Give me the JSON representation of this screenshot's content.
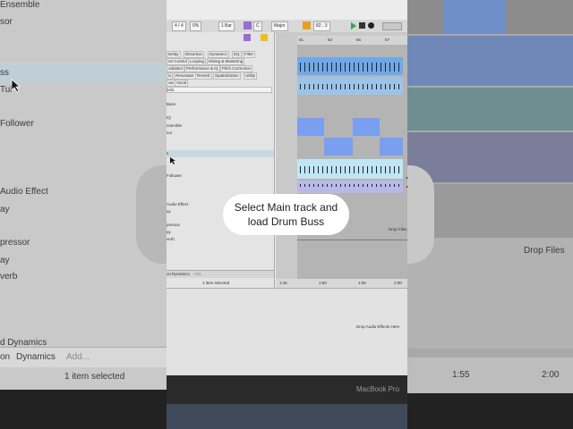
{
  "left_panel": {
    "items": [
      "Ensemble",
      "sor",
      "ss",
      "Tul",
      "Follower",
      "Audio Effect",
      "ay",
      "pressor",
      "ay",
      "verb",
      "d Dynamics"
    ],
    "tabs": [
      "on",
      "Dynamics",
      "Add..."
    ],
    "status": "1 item selected"
  },
  "right_panel": {
    "drop_text": "Drop Files",
    "time_labels": [
      "1:55",
      "2:00"
    ]
  },
  "toolbar": {
    "sig": "4 / 4",
    "zoom": "0%",
    "quant": "1 Bar",
    "key_root": "C",
    "key_mode": "Major",
    "position": "82 . 3"
  },
  "browser": {
    "tags_row1": [
      "Delay",
      "Distortion",
      "Dynamics",
      "EQ",
      "Filter"
    ],
    "tags_row2": [
      "ne Control",
      "Looping",
      "Mixing & Mastering"
    ],
    "tags_row3": [
      "odulator",
      "Performance & Dj",
      "Pitch Correction"
    ],
    "tags_row4": [
      "ix",
      "Resonator",
      "Reverb",
      "Spatialization",
      "Utility"
    ],
    "tags_row5": [
      "ow",
      "Vocal"
    ],
    "items": [
      "ordL",
      "Bass",
      "IQ",
      "nsemble",
      "sor",
      "s",
      "Follower",
      "Audio Effect",
      "ay",
      "pressor",
      "ay",
      "verb"
    ],
    "bottom_tabs": [
      "on",
      "Dynamics",
      "Add..."
    ],
    "status": "1 item selected"
  },
  "arrangement": {
    "bar_numbers": [
      "61",
      "63",
      "65",
      "67"
    ],
    "drop_text": "Drop Files",
    "time_labels": [
      "1:45",
      "1:50",
      "1:55",
      "2:00"
    ]
  },
  "device_view": {
    "drop_text": "Drop Audio Effects Here"
  },
  "laptop": {
    "brand": "MacBook Pro"
  },
  "caption": {
    "line1": "Select Main track and",
    "line2": "load Drum Buss"
  }
}
